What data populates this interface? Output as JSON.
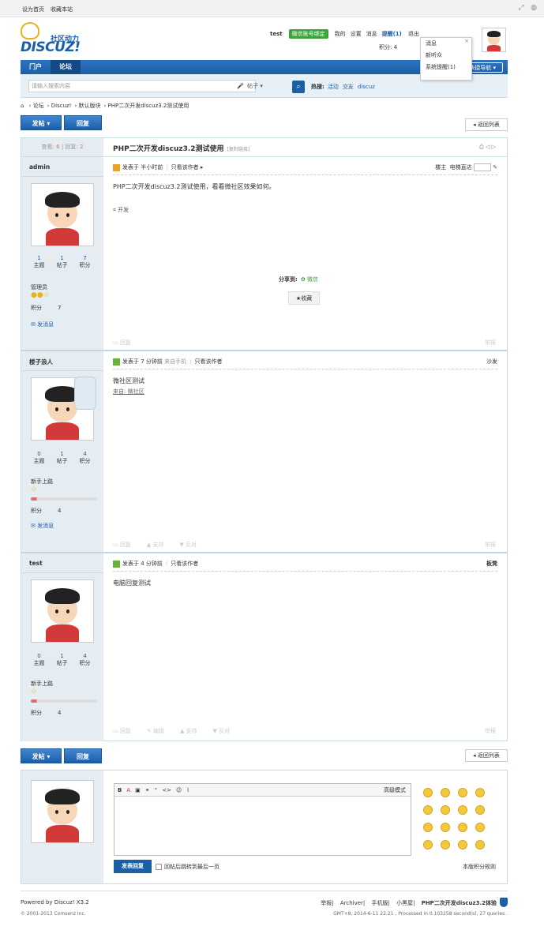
{
  "topbar": {
    "set_home": "设为首页",
    "favorite": "收藏本站"
  },
  "logo": {
    "cn": "社区动力",
    "en": "DISCUZ!"
  },
  "userbar": {
    "username": "test",
    "wechat": "微信账号绑定",
    "mine": "我的",
    "settings": "设置",
    "messages": "消息",
    "remind": "提醒(1)",
    "logout": "退出",
    "credits": "积分: 4"
  },
  "dropdown": {
    "items": [
      "消息",
      "新听众",
      "系统提醒(1)"
    ]
  },
  "nav": {
    "tabs": [
      "门户",
      "论坛"
    ],
    "quick": "快捷导航"
  },
  "search": {
    "placeholder": "请输入搜索内容",
    "type": "帖子",
    "hot_label": "热搜:",
    "hot": [
      "活动",
      "交友",
      "discuz"
    ]
  },
  "breadcrumb": [
    "论坛",
    "Discuz!",
    "默认版块",
    "PHP二次开发discuz3.2测试使用"
  ],
  "buttons": {
    "post": "发帖",
    "reply": "回复",
    "back": "返回列表"
  },
  "thread": {
    "views_label": "查看:",
    "views": "6",
    "replies_label": "回复:",
    "replies": "2",
    "title": "PHP二次开发discuz3.2测试使用",
    "copy": "[复制链接]"
  },
  "posts": [
    {
      "author": "admin",
      "stats": [
        {
          "v": "1",
          "l": "主题"
        },
        {
          "v": "1",
          "l": "帖子"
        },
        {
          "v": "7",
          "l": "积分"
        }
      ],
      "group": "管理员",
      "points_label": "积分",
      "points": "7",
      "send_msg": "发消息",
      "time": "发表于 半小时前",
      "only_author": "只看该作者",
      "floor": "楼主",
      "floor_extra": "电梯直达",
      "content": "PHP二次开发discuz3.2测试使用，看看微社区效果如何。",
      "tag": "开发",
      "share_label": "分享到:",
      "share_wx": "微信",
      "fav": "收藏",
      "actions": [
        "回复"
      ],
      "report": "举报"
    },
    {
      "author": "楼子浪人",
      "stats": [
        {
          "v": "0",
          "l": "主题"
        },
        {
          "v": "1",
          "l": "帖子"
        },
        {
          "v": "4",
          "l": "积分"
        }
      ],
      "group": "新手上路",
      "points_label": "积分",
      "points": "4",
      "send_msg": "发消息",
      "time": "发表于 7 分钟前",
      "from_mobile": "来自手机",
      "only_author": "只看该作者",
      "floor": "沙发",
      "content": "微社区测试",
      "source": "来自: 微社区",
      "actions": [
        "回复",
        "支持",
        "反对"
      ],
      "report": "举报"
    },
    {
      "author": "test",
      "stats": [
        {
          "v": "0",
          "l": "主题"
        },
        {
          "v": "1",
          "l": "帖子"
        },
        {
          "v": "4",
          "l": "积分"
        }
      ],
      "group": "新手上路",
      "points_label": "积分",
      "points": "4",
      "time": "发表于 4 分钟前",
      "only_author": "只看该作者",
      "floor": "板凳",
      "content": "电脑回复测试",
      "actions": [
        "回复",
        "编辑",
        "支持",
        "反对"
      ],
      "report": "举报"
    }
  ],
  "reply": {
    "advanced": "高级模式",
    "submit": "发表回复",
    "jump": "回帖后跳转到最后一页",
    "rules": "本版积分规则"
  },
  "footer": {
    "powered": "Powered by Discuz! X3.2",
    "copyright": "© 2001-2013 Comsenz Inc.",
    "links": [
      "举报",
      "Archiver",
      "手机版",
      "小黑屋",
      "PHP二次开发discuz3.2体验"
    ],
    "gmt": "GMT+8, 2014-6-11 22:21 , Processed in 0.103258 second(s), 27 queries ."
  }
}
